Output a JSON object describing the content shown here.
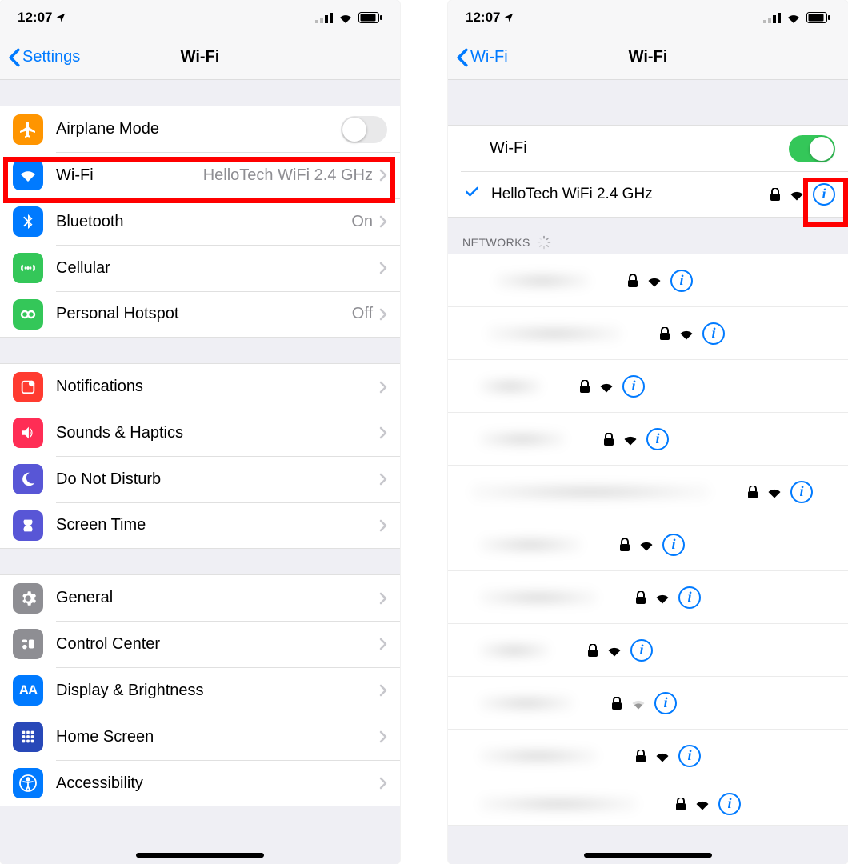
{
  "statusbar": {
    "time": "12:07"
  },
  "left": {
    "back": "Settings",
    "title": "Wi-Fi",
    "rows": {
      "airplane": "Airplane Mode",
      "wifi": "Wi-Fi",
      "wifi_value": "HelloTech WiFi 2.4 GHz",
      "bluetooth": "Bluetooth",
      "bluetooth_value": "On",
      "cellular": "Cellular",
      "hotspot": "Personal Hotspot",
      "hotspot_value": "Off",
      "notifications": "Notifications",
      "sounds": "Sounds & Haptics",
      "dnd": "Do Not Disturb",
      "screentime": "Screen Time",
      "general": "General",
      "controlcenter": "Control Center",
      "display": "Display & Brightness",
      "homescreen": "Home Screen",
      "accessibility": "Accessibility"
    }
  },
  "right": {
    "back": "Wi-Fi",
    "title": "Wi-Fi",
    "wifi_label": "Wi-Fi",
    "connected": "HelloTech WiFi 2.4 GHz",
    "networks_header": "NETWORKS"
  }
}
